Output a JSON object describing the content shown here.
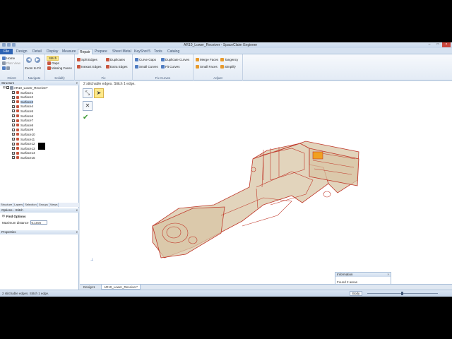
{
  "window": {
    "title": "AR10_Lower_Receiver - SpaceClaim Engineer"
  },
  "tabs": [
    "File",
    "Design",
    "Detail",
    "Display",
    "Measure",
    "Repair",
    "Prepare",
    "Sheet Metal",
    "KeyShot 5",
    "Tools",
    "Catalog"
  ],
  "ribbon": {
    "orient": {
      "label": "Orient",
      "home": "Home",
      "plan_view": "Plan View",
      "zoom_to_fit": "Zoom to Fit"
    },
    "navigate": {
      "label": "Navigate"
    },
    "solidify": {
      "label": "Solidify",
      "stitch": "Stitch",
      "gaps": "Gaps",
      "missing_faces": "Missing Faces"
    },
    "fix": {
      "label": "Fix",
      "split_edges": "Split Edges",
      "inexact_edges": "Inexact Edges",
      "duplicates": "Duplicates",
      "extra_edges": "Extra Edges"
    },
    "fix_curves": {
      "label": "Fix Curves",
      "curve_gaps": "Curve Gaps",
      "small_curves": "Small Curves",
      "duplicate_curves": "Duplicate Curves",
      "fit_curves": "Fit Curves"
    },
    "adjust": {
      "label": "Adjust",
      "merge_faces": "Merge Faces",
      "small_faces": "Small Faces",
      "tangency": "Tangency",
      "simplify": "Simplify"
    }
  },
  "structure": {
    "title": "Structure",
    "root": "AR10_Lower_Receiver*",
    "items": [
      "Surface1",
      "Surface2",
      "Surface3",
      "Surface4",
      "Surface5",
      "Surface6",
      "Surface7",
      "Surface8",
      "Surface9",
      "Surface10",
      "Surface11",
      "Surface12",
      "Surface13",
      "Surface14",
      "Surface15"
    ],
    "selected_index": 2,
    "panel_tabs": [
      "Structure",
      "Layers",
      "Selection",
      "Groups",
      "Views"
    ]
  },
  "options": {
    "title": "Options - Stitch",
    "section": "Find Options",
    "max_distance_label": "Maximum distance",
    "max_distance_value": "0.1mm"
  },
  "properties": {
    "title": "Properties"
  },
  "viewport": {
    "info": "2 stitchable edges. Stitch 1 edge.",
    "tool1_icon": "select-edges-icon",
    "tool2_icon": "pointer-icon",
    "tool3_icon": "exclude-icon",
    "complete_icon": "check-icon"
  },
  "colors": {
    "edge": "#c0392b",
    "fill": "#c8b08a",
    "highlight": "#f0a020",
    "ribbon_accent": "#2d63b4"
  },
  "doc_tabs": [
    "Design1",
    "AR10_Lower_Receiver*"
  ],
  "info_panel": {
    "title": "Information",
    "message": "Found 2 areas"
  },
  "status": {
    "message": "2 stitchable edges. Stitch 1 edge.",
    "mode": "Body"
  }
}
